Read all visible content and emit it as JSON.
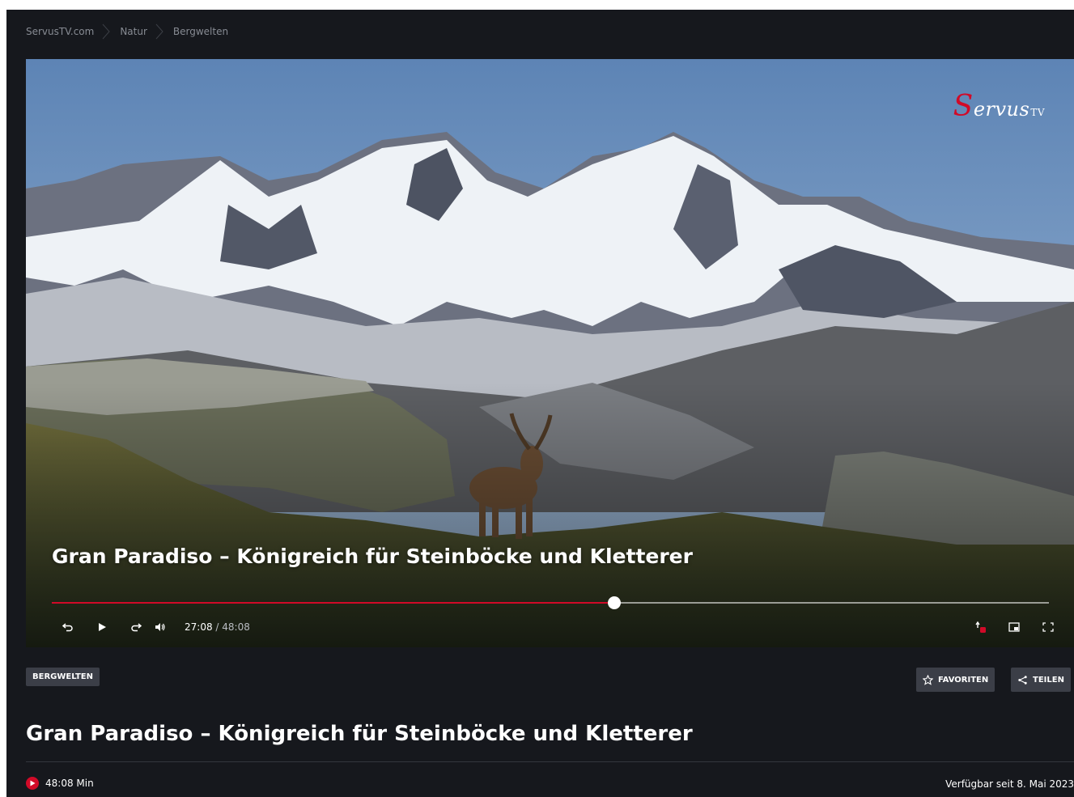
{
  "breadcrumb": [
    "ServusTV.com",
    "Natur",
    "Bergwelten"
  ],
  "player": {
    "logo": {
      "prefix": "S",
      "text": "ervus",
      "suffix": "TV"
    },
    "title": "Gran Paradiso – Königreich für Steinböcke und Kletterer",
    "progress_fraction": 0.564,
    "current_time": "27:08",
    "duration": "48:08",
    "icons": [
      "rewind-icon",
      "play-icon",
      "forward-icon",
      "volume-icon",
      "subtitles-icon",
      "picture-in-picture-icon",
      "fullscreen-icon"
    ]
  },
  "tag": "BERGWELTEN",
  "actions": {
    "favorites": "FAVORITEN",
    "share": "TEILEN"
  },
  "page_title": "Gran Paradiso – Königreich für Steinböcke und Kletterer",
  "meta": {
    "duration": "48:08 Min",
    "availability": "Verfügbar seit 8. Mai 2023"
  },
  "colors": {
    "accent": "#d10a28",
    "background": "#16181d",
    "chip": "#3b3e47"
  }
}
